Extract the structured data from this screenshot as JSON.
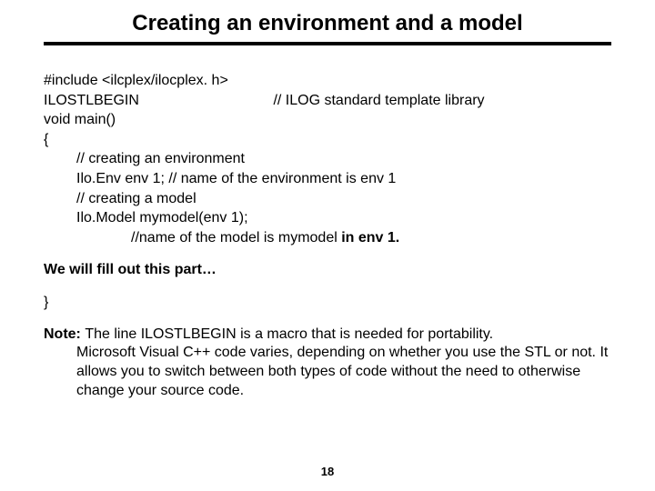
{
  "title": "Creating an environment and a model",
  "code": {
    "l1": "#include <ilcplex/ilocplex. h>",
    "l2a": "ILOSTLBEGIN",
    "l2b": "// ILOG standard template library",
    "l3": "void main()",
    "l4": "{",
    "l5": "// creating an environment",
    "l6": "Ilo.Env env 1;   // name of the environment is env 1",
    "l7": "// creating a model",
    "l8": "Ilo.Model mymodel(env 1);",
    "l9a": "//name of the model is mymodel ",
    "l9b": "in env 1.",
    "l10": "We will fill out this part…",
    "l11": "}"
  },
  "note": {
    "label": "Note: ",
    "line1": "The line ILOSTLBEGIN is a macro that is needed for portability.",
    "rest": "Microsoft Visual C++ code varies, depending on whether you use the STL or not. It  allows you to switch between both types of code without the need to otherwise change your source code."
  },
  "page": "18"
}
